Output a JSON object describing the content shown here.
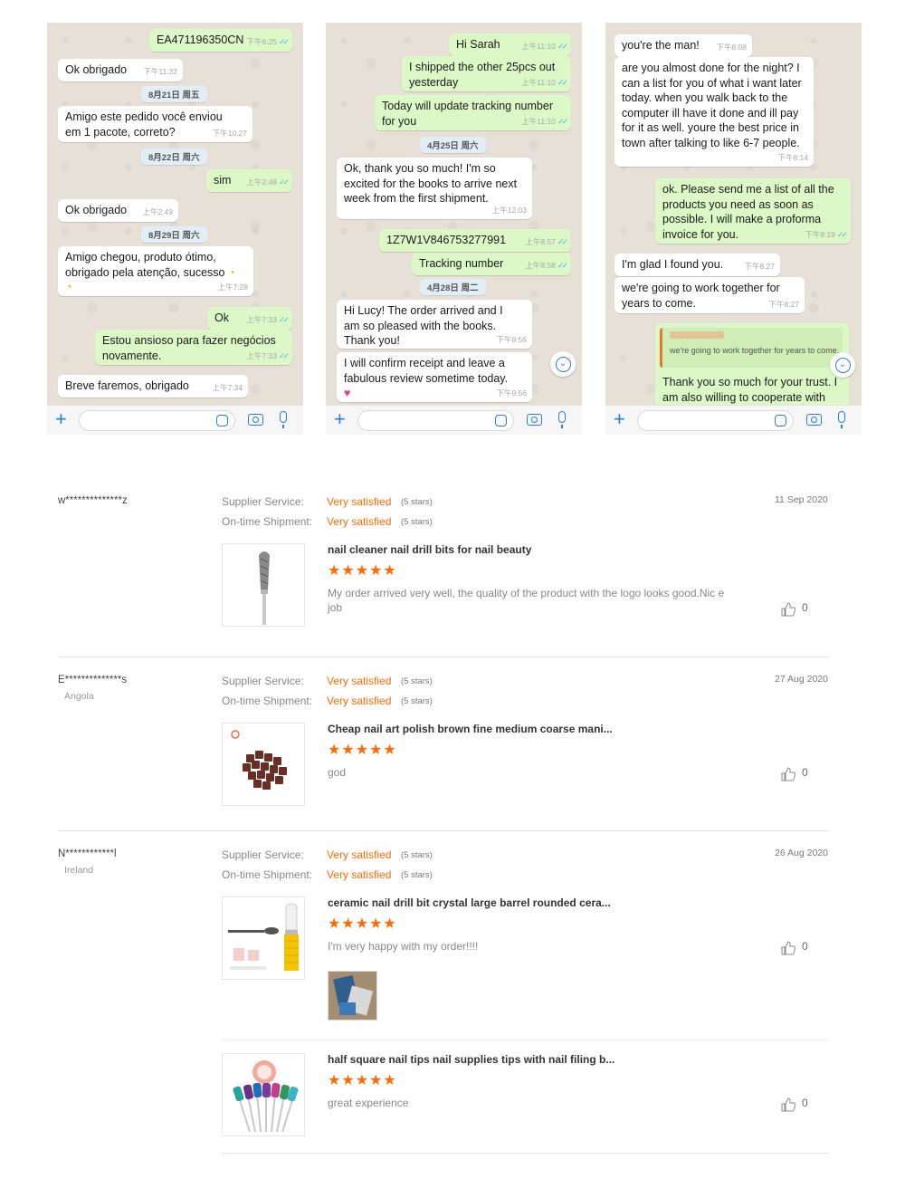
{
  "chat1": {
    "messages": [
      {
        "text": "EA471196350CN",
        "time": "下午6:25"
      },
      {
        "text": "Ok obrigado",
        "time": "下午11:32"
      },
      {
        "text": "8月21日 周五"
      },
      {
        "text": "Amigo este pedido você enviou em 1 pacote, correto?",
        "time": "下午10:27"
      },
      {
        "text": "8月22日 周六"
      },
      {
        "text": "sim",
        "time": "上午2:48"
      },
      {
        "text": "Ok obrigado",
        "time": "上午2:49"
      },
      {
        "text": "8月29日 周六"
      },
      {
        "text": "Amigo chegou, produto ótimo, obrigado pela atenção, sucesso",
        "time": "上午7:28"
      },
      {
        "text": "Ok",
        "time": "上午7:33"
      },
      {
        "text": "Estou ansioso para fazer negócios novamente.",
        "time": "上午7:33"
      },
      {
        "text": "Breve faremos, obrigado",
        "time": "上午7:34"
      }
    ]
  },
  "chat2": {
    "messages": [
      {
        "text": "Hi Sarah",
        "time": "上午11:10"
      },
      {
        "text": "I shipped the other 25pcs out yesterday",
        "time": "上午11:10"
      },
      {
        "text": "Today will update tracking number for you",
        "time": "上午11:10"
      },
      {
        "text": "4月25日 周六"
      },
      {
        "text": "Ok, thank you so much! I'm so excited for the books to arrive next week from the first shipment.",
        "time": "上午12:03"
      },
      {
        "text": "1Z7W1V846753277991",
        "time": "上午8:57"
      },
      {
        "text": "Tracking number",
        "time": "上午8:58"
      },
      {
        "text": "4月28日 周二"
      },
      {
        "text": "Hi Lucy! The order arrived and I am so pleased with the books. Thank you!",
        "time": "下午9:56"
      },
      {
        "text": "I will confirm receipt and leave a fabulous review sometime today.",
        "time": "下午9:56"
      }
    ]
  },
  "chat3": {
    "messages": [
      {
        "text": "you're the man!",
        "time": "下午8:08"
      },
      {
        "text": "are you almost done for the night? I can a list for you of what i want later today.  when you walk back to the computer ill have it done and ill pay for it as well.  youre the best price in town after talking to like 6-7 people.",
        "time": "下午8:14"
      },
      {
        "text": "ok.  Please send me a list of all the products you need as soon as possible.  I will make a proforma invoice for you.",
        "time": "下午8:19"
      },
      {
        "text": "I'm glad I found you.",
        "time": "下午8:27"
      },
      {
        "text": "we're going to work together for years to come.",
        "time": "下午8:27"
      },
      {
        "text": "we're going to work together for years to come."
      },
      {
        "text": "Thank you so much for your trust. I am also willing to cooperate with"
      }
    ]
  },
  "reviews": [
    {
      "user": "w**************z",
      "country": "",
      "supplier_label": "Supplier Service:",
      "supplier_value": "Very satisfied",
      "supplier_stars": "(5 stars)",
      "shipment_label": "On-time Shipment:",
      "shipment_value": "Very satisfied",
      "shipment_stars": "(5 stars)",
      "date": "11 Sep 2020",
      "items": [
        {
          "title": "nail cleaner nail drill bits for nail beauty",
          "rating": 5,
          "comment": "My order arrived very well, the quality of the product with the logo looks good.Nic e job",
          "likes": "0"
        }
      ]
    },
    {
      "user": "E**************s",
      "country": "Angola",
      "supplier_label": "Supplier Service:",
      "supplier_value": "Very satisfied",
      "supplier_stars": "(5 stars)",
      "shipment_label": "On-time Shipment:",
      "shipment_value": "Very satisfied",
      "shipment_stars": "(5 stars)",
      "date": "27 Aug 2020",
      "items": [
        {
          "title": "Cheap nail art polish brown fine medium coarse mani...",
          "rating": 5,
          "comment": "god",
          "likes": "0"
        }
      ]
    },
    {
      "user": "N************l",
      "country": "Ireland",
      "supplier_label": "Supplier Service:",
      "supplier_value": "Very satisfied",
      "supplier_stars": "(5 stars)",
      "shipment_label": "On-time Shipment:",
      "shipment_value": "Very satisfied",
      "shipment_stars": "(5 stars)",
      "date": "26 Aug 2020",
      "items": [
        {
          "title": "ceramic nail drill bit crystal large barrel rounded cera...",
          "rating": 5,
          "comment": "I'm very happy with my order!!!!",
          "likes": "0"
        },
        {
          "title": "half square nail tips nail supplies tips with nail filing b...",
          "rating": 5,
          "comment": "great experience",
          "likes": "0"
        }
      ]
    }
  ],
  "colors": {
    "accent": "#ff6a00",
    "chat_out": "#dcf8c6",
    "chat_in": "#ffffff",
    "chat_bg": "#e6e0d6",
    "whatsapp_blue": "#2a7fd4"
  }
}
